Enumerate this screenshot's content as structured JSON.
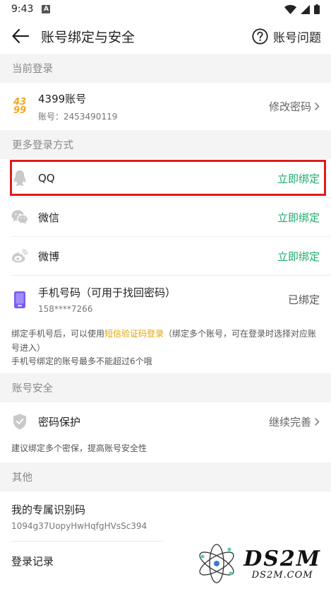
{
  "status_bar": {
    "time": "9:43",
    "notif_letter": "A"
  },
  "header": {
    "title": "账号绑定与安全",
    "help_label": "账号问题"
  },
  "current_login": {
    "section_title": "当前登录",
    "logo_top": "43",
    "logo_bottom": "99",
    "account_name": "4399账号",
    "account_id": "账号：2453490119",
    "action": "修改密码"
  },
  "more_login": {
    "section_title": "更多登录方式",
    "items": [
      {
        "label": "QQ",
        "action": "立即绑定",
        "icon": "qq-icon"
      },
      {
        "label": "微信",
        "action": "立即绑定",
        "icon": "wechat-icon"
      },
      {
        "label": "微博",
        "action": "立即绑定",
        "icon": "weibo-icon"
      }
    ],
    "phone": {
      "label": "手机号码（可用于找回密码）",
      "number": "158****7266",
      "status": "已绑定"
    },
    "note_part1": "绑定手机号后，可以使用",
    "note_link": "短信验证码登录",
    "note_part2": "（绑定多个账号，可在登录时选择对应账号进入）",
    "note_line2": "手机号绑定的账号最多不能超过6个哦"
  },
  "account_security": {
    "section_title": "账号安全",
    "item_label": "密码保护",
    "item_action": "继续完善",
    "note": "建议绑定多个密保，提高账号安全性"
  },
  "other": {
    "section_title": "其他",
    "id_label": "我的专属识别码",
    "id_value": "1094g37UopyHwHqfgHVsSc394",
    "login_record": "登录记录"
  },
  "watermark": {
    "big": "DS2M",
    "small": "DS2M.COM"
  },
  "colors": {
    "green": "#1dab6c",
    "highlight": "#e01a1a",
    "link": "#e5a400",
    "logo": "#f5a623",
    "phone": "#7b5cf0"
  }
}
